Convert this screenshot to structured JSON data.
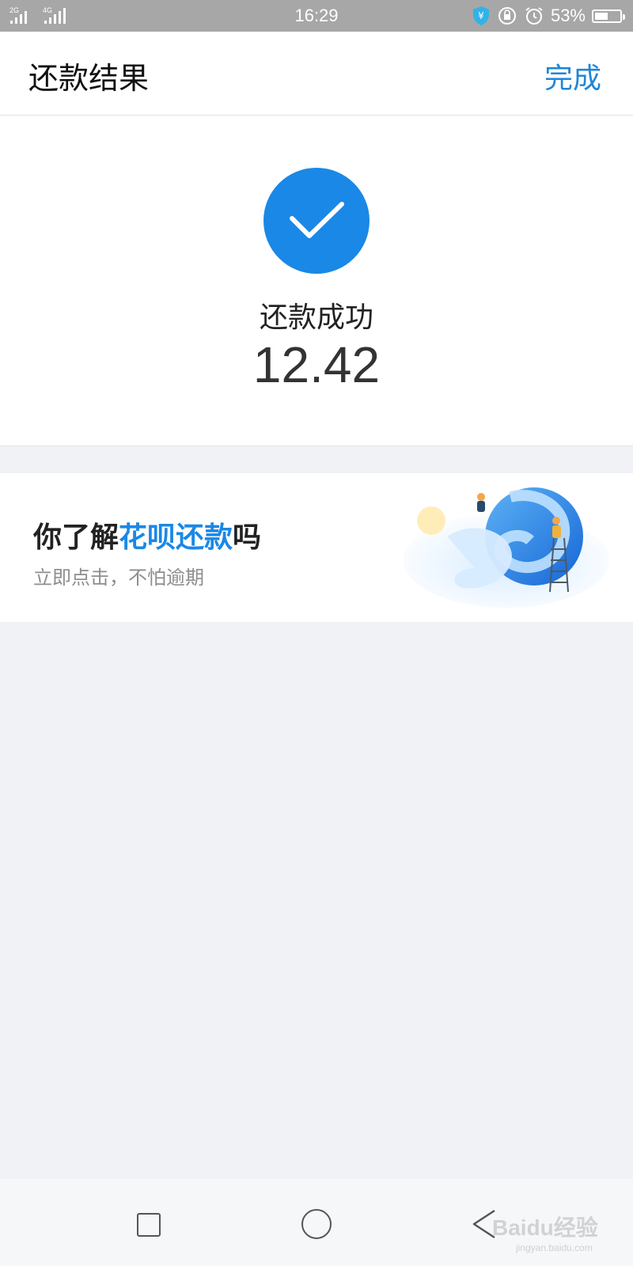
{
  "status_bar": {
    "signal_1_label": "2G",
    "signal_2_label": "4G",
    "time": "16:29",
    "battery_percent": "53%",
    "battery_level": 0.53,
    "icons": [
      "alipay-shield-icon",
      "rotation-lock-icon",
      "alarm-clock-icon",
      "battery-icon"
    ]
  },
  "nav": {
    "title": "还款结果",
    "done_label": "完成"
  },
  "result": {
    "status": "还款成功",
    "amount": "12.42",
    "icon": "check-icon",
    "accent_color": "#1a88e6"
  },
  "promo": {
    "title_prefix": "你了解",
    "title_highlight": "花呗还款",
    "title_suffix": "吗",
    "subtitle": "立即点击，不怕逾期",
    "illustration": "globe-with-people-illustration"
  },
  "system_nav": {
    "buttons": [
      "recent-apps-button",
      "home-button",
      "back-button"
    ]
  },
  "watermark": {
    "text": "Baidu经验",
    "url_text": "jingyan.baidu.com"
  }
}
